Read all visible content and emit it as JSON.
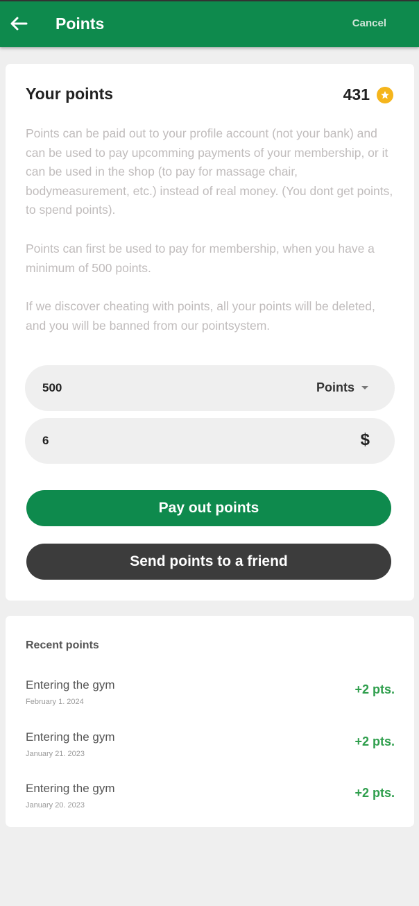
{
  "header": {
    "title": "Points",
    "cancel_label": "Cancel",
    "back_icon": "arrow-left-icon"
  },
  "colors": {
    "primary_green": "#0e8a4d",
    "dark_button": "#3c3c3c",
    "points_green": "#2e9e4c",
    "star_gold": "#f5b51c"
  },
  "summary": {
    "title": "Your points",
    "balance": "431",
    "balance_icon": "star-icon",
    "info": [
      "Points can be paid out to your profile account (not your bank) and can be used to pay upcomming payments of your membership, or it can be used in the shop (to pay for massage chair, bodymeasurement, etc.) instead of real money. (You dont get points, to spend points).",
      "Points can first be used to pay for membership, when you have a minimum of 500 points.",
      "If we discover cheating with points, all your points will be deleted, and you will be banned from our pointsystem."
    ]
  },
  "form": {
    "points_value": "500",
    "points_unit": "Points",
    "money_value": "6",
    "currency_symbol": "$"
  },
  "actions": {
    "pay_out_label": "Pay out points",
    "send_label": "Send points to a friend"
  },
  "recent": {
    "title": "Recent points",
    "items": [
      {
        "title": "Entering the gym",
        "date": "February 1. 2024",
        "points": "+2 pts."
      },
      {
        "title": "Entering the gym",
        "date": "January 21. 2023",
        "points": "+2 pts."
      },
      {
        "title": "Entering the gym",
        "date": "January 20. 2023",
        "points": "+2 pts."
      }
    ]
  }
}
